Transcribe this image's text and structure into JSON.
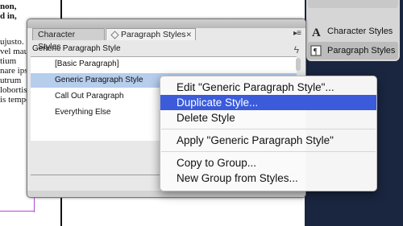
{
  "document": {
    "lines": [
      {
        "text": "non,",
        "bold": true
      },
      {
        "text": "d in,",
        "bold": true
      },
      {
        "text": "ujusto.",
        "bold": false
      },
      {
        "text": "vel mau-",
        "bold": false
      },
      {
        "text": "tium",
        "bold": false
      },
      {
        "text": "nare ipsum",
        "bold": false
      },
      {
        "text": "utrum",
        "bold": false
      },
      {
        "text": "lobortis",
        "bold": false
      },
      {
        "text": "is tempo",
        "bold": false
      }
    ]
  },
  "right_panel": {
    "top_label": "",
    "items": [
      {
        "label": "Character Styles",
        "icon": "character-styles-icon"
      },
      {
        "label": "Paragraph Styles",
        "icon": "paragraph-styles-icon",
        "selected": true
      }
    ]
  },
  "panel": {
    "tabs": [
      {
        "label": "Character Styles",
        "active": false
      },
      {
        "label": "Paragraph Styles",
        "active": true
      }
    ],
    "close_symbol": "✕",
    "menu_symbol": "▸≡",
    "current_style": "Generic Paragraph Style",
    "lightning_symbol": "ϟ",
    "styles": [
      {
        "label": "[Basic Paragraph]"
      },
      {
        "label": "Generic Paragraph Style",
        "selected": true
      },
      {
        "label": "Call Out Paragraph"
      },
      {
        "label": "Everything Else"
      }
    ]
  },
  "context_menu": {
    "items": [
      {
        "label": "Edit \"Generic Paragraph Style\"...",
        "highlighted": false
      },
      {
        "label": "Duplicate Style...",
        "highlighted": true
      },
      {
        "label": "Delete Style",
        "highlighted": false
      },
      {
        "label": "Apply \"Generic Paragraph Style\"",
        "highlighted": false
      },
      {
        "label": "Copy to Group...",
        "highlighted": false
      },
      {
        "label": "New Group from Styles...",
        "highlighted": false
      }
    ]
  },
  "colors": {
    "highlight": "#3b5bdb",
    "selected_row": "#b6cdec",
    "dark_background": "#1a2640"
  }
}
